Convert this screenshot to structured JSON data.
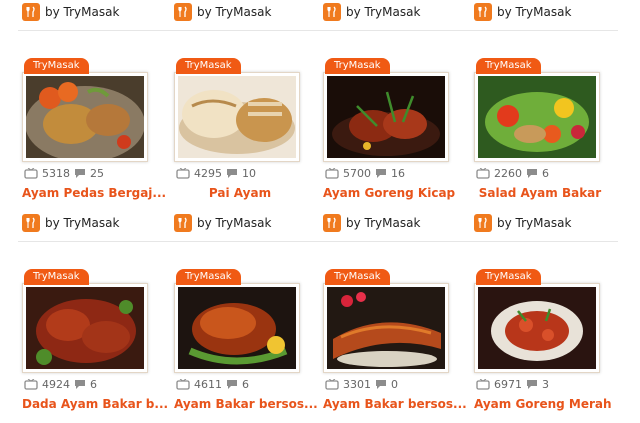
{
  "author_label": "by TryMasak",
  "tag_label": "TryMasak",
  "colors": {
    "accent": "#f05a14",
    "title": "#e8541b",
    "badge": "#f07a1e"
  },
  "icons": {
    "author": "fork-spoon-icon",
    "views": "tv-icon",
    "comments": "speech-bubble-icon"
  },
  "recipes": [
    {
      "title": "Ayam Pedas Bergaj...",
      "views": "5318",
      "comments": "25"
    },
    {
      "title": "Pai Ayam",
      "views": "4295",
      "comments": "10"
    },
    {
      "title": "Ayam Goreng Kicap",
      "views": "5700",
      "comments": "16"
    },
    {
      "title": "Salad Ayam Bakar",
      "views": "2260",
      "comments": "6"
    },
    {
      "title": "Dada Ayam Bakar b...",
      "views": "4924",
      "comments": "6"
    },
    {
      "title": "Ayam Bakar bersos...",
      "views": "4611",
      "comments": "6"
    },
    {
      "title": "Ayam Bakar bersos...",
      "views": "3301",
      "comments": "0"
    },
    {
      "title": "Ayam Goreng Merah",
      "views": "6971",
      "comments": "3"
    }
  ]
}
